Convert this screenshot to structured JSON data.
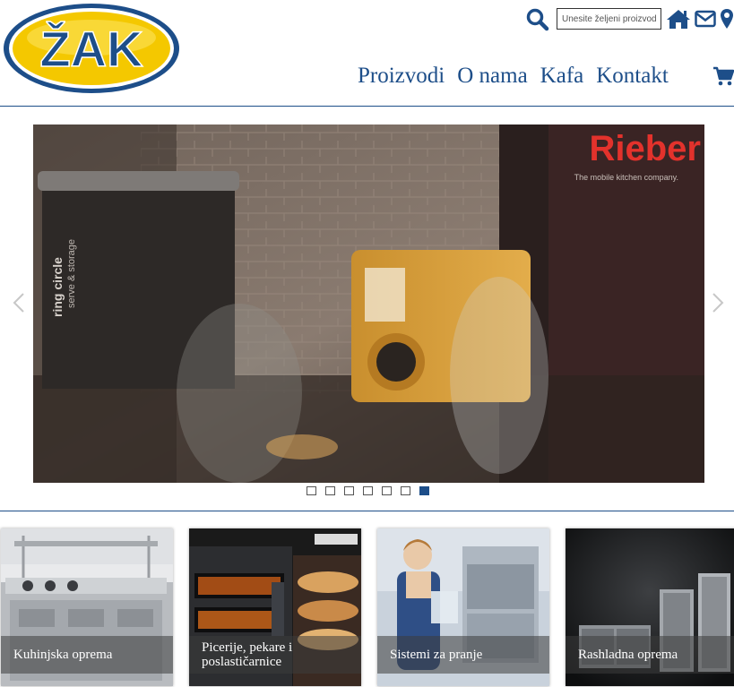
{
  "brand": {
    "logo_text": "ŽAK",
    "color_primary": "#1d4e89",
    "color_logo_yellow": "#f4c800"
  },
  "header": {
    "search": {
      "placeholder": "Unesite željeni proizvod",
      "value": ""
    },
    "icons": [
      "search-icon",
      "home-icon",
      "mail-icon",
      "map-pin-icon",
      "cart-icon"
    ]
  },
  "nav": {
    "items": [
      {
        "label": "Proizvodi"
      },
      {
        "label": "O nama"
      },
      {
        "label": "Kafa"
      },
      {
        "label": "Kontakt"
      }
    ]
  },
  "slider": {
    "brand_text": "Rieber",
    "tagline": "The mobile kitchen company.",
    "side_text_1": "ring circle",
    "side_text_2": "serve & storage",
    "slide_count": 7,
    "active_slide": 7
  },
  "tiles": [
    {
      "label": "Kuhinjska oprema"
    },
    {
      "label": "Picerije, pekare i poslastičarnice"
    },
    {
      "label": "Sistemi za pranje"
    },
    {
      "label": "Rashladna oprema"
    }
  ]
}
